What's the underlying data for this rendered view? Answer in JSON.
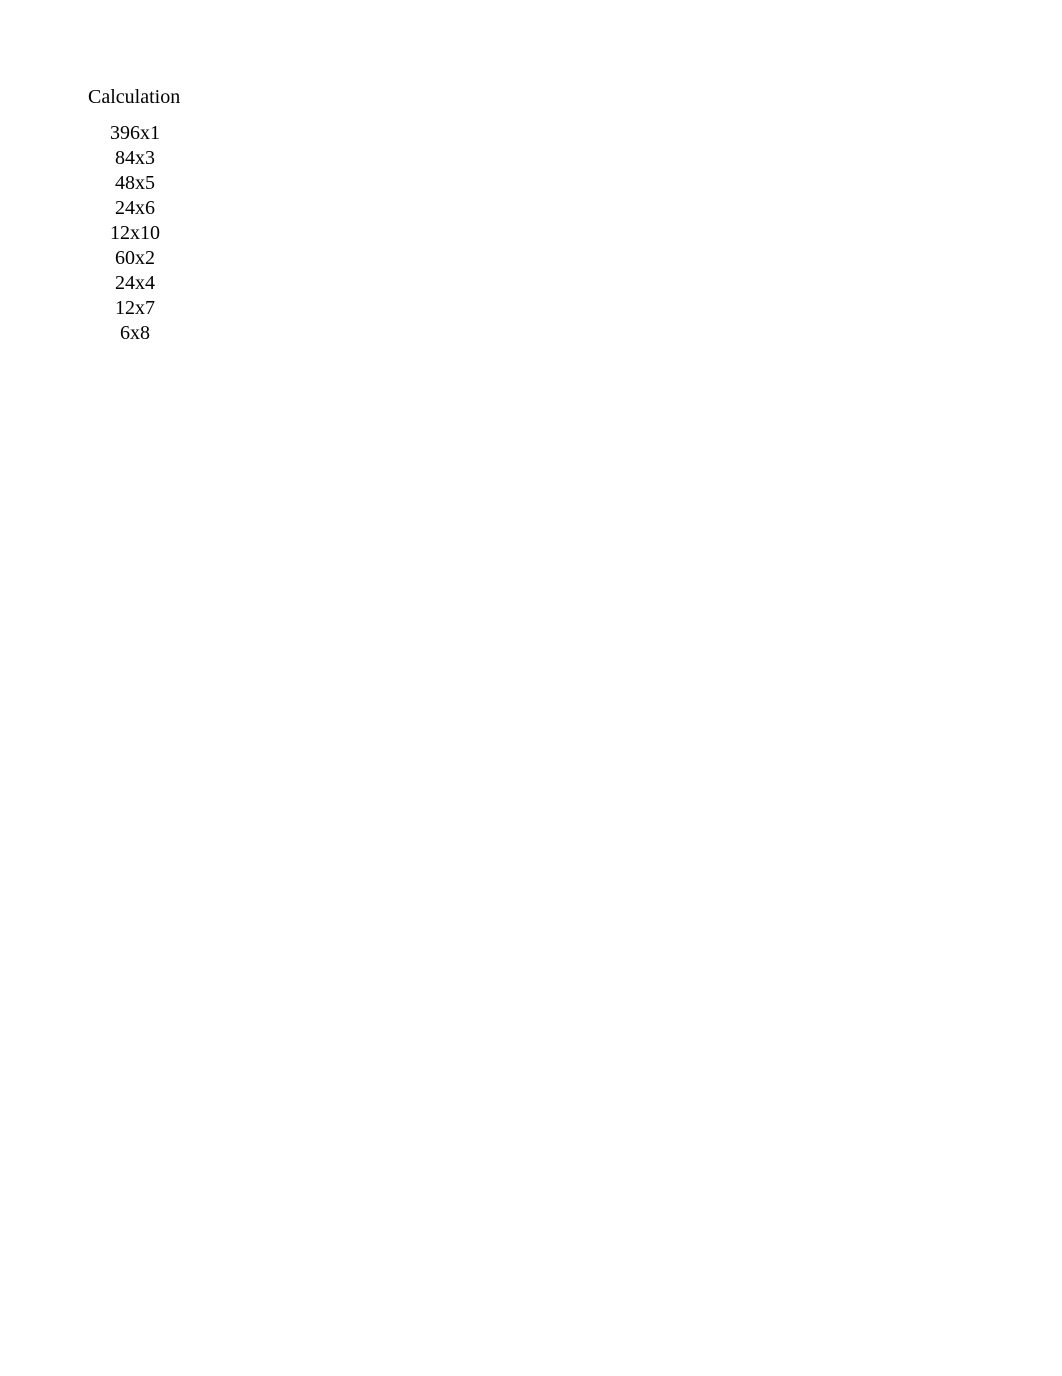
{
  "header": "Calculation",
  "rows": [
    "396x1",
    "84x3",
    "48x5",
    "24x6",
    "12x10",
    "60x2",
    "24x4",
    "12x7",
    "6x8"
  ]
}
